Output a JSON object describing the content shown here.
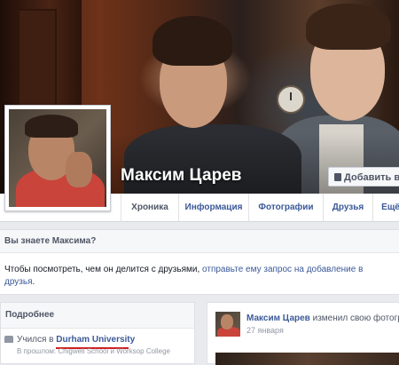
{
  "profile": {
    "name": "Максим Царев",
    "add_friend_label": "Добавить в д"
  },
  "nav": {
    "tabs": [
      {
        "label": "Хроника",
        "active": true
      },
      {
        "label": "Информация",
        "active": false
      },
      {
        "label": "Фотографии",
        "active": false
      },
      {
        "label": "Друзья",
        "active": false
      },
      {
        "label": "Ещё",
        "active": false
      }
    ]
  },
  "know_box": {
    "title": "Вы знаете Максима?",
    "text": "Чтобы посмотреть, чем он делится с друзьями, ",
    "link": "отправьте ему запрос на добавление в друзья",
    "end": "."
  },
  "about": {
    "title": "Подробнее",
    "study_prefix": "Учился в ",
    "study_link": "Durham University",
    "past_text": "В прошлом: Chigwell School и Worksop College"
  },
  "post": {
    "author": "Максим Царев",
    "action": "изменил свою фотограф",
    "date": "27 января"
  },
  "colors": {
    "link": "#3b5998",
    "underline": "#d21e1e"
  }
}
